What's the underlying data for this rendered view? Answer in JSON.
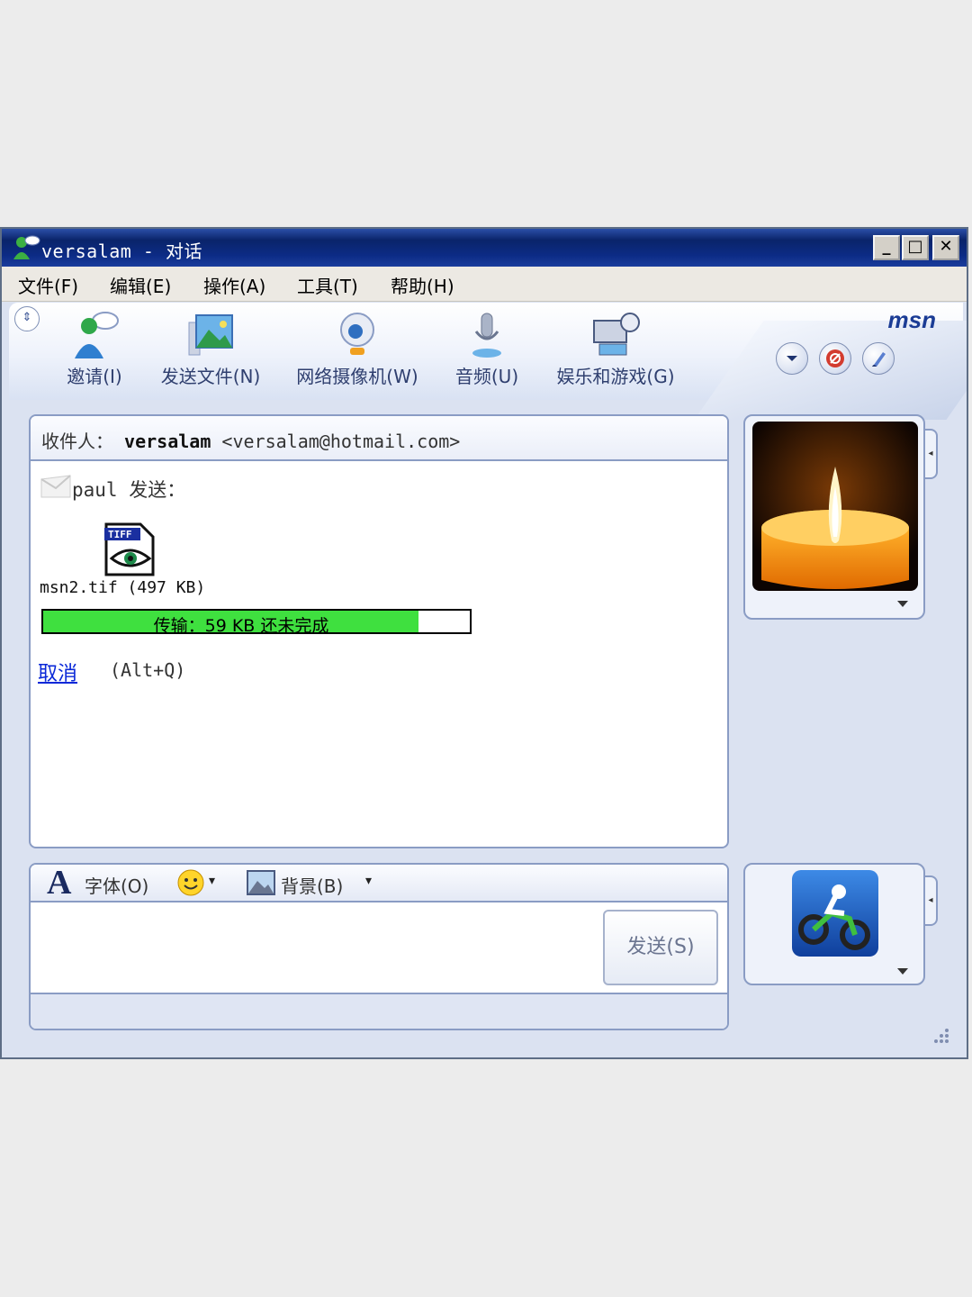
{
  "window": {
    "title": "versalam - 对话",
    "minimize": "_",
    "maximize": "□",
    "close": "✕"
  },
  "menu": [
    "文件(F)",
    "编辑(E)",
    "操作(A)",
    "工具(T)",
    "帮助(H)"
  ],
  "toolbar": {
    "collapse": "⇕",
    "items": [
      {
        "label": "邀请(I)",
        "icon": "invite-icon"
      },
      {
        "label": "发送文件(N)",
        "icon": "send-file-icon"
      },
      {
        "label": "网络摄像机(W)",
        "icon": "webcam-icon"
      },
      {
        "label": "音频(U)",
        "icon": "audio-icon"
      },
      {
        "label": "娱乐和游戏(G)",
        "icon": "games-icon"
      }
    ],
    "logo": "msn",
    "chevron": "▾"
  },
  "conversation": {
    "to_label": "收件人：",
    "to_name": "versalam",
    "to_email": "<versalam@hotmail.com>",
    "sender_line": "paul 发送：",
    "file_badge": "TIFF",
    "file_info": "msn2.tif (497 KB)",
    "progress_text": "传输：59 KB 还未完成",
    "progress_fraction": 0.88,
    "cancel_label": "取消",
    "cancel_shortcut": "(Alt+Q)"
  },
  "compose": {
    "font_label": "字体(O)",
    "font_glyph": "A",
    "background_label": "背景(B)",
    "dropdown_arrow": "▾",
    "send_label": "发送(S)"
  },
  "colors": {
    "titlebar": "#0a246a",
    "progress": "#3fe03f",
    "link": "#0a28d8"
  }
}
